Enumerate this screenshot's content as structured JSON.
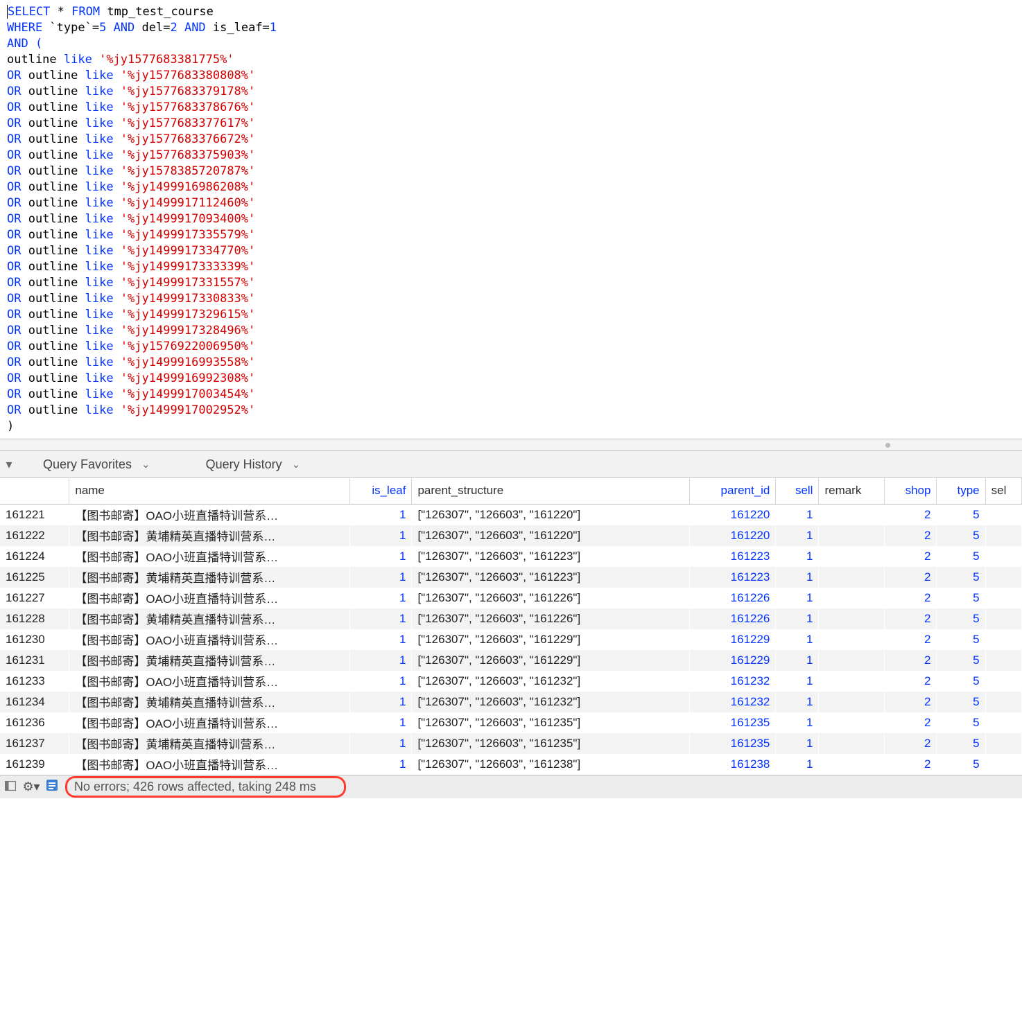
{
  "sql": {
    "l0_select": "SELECT",
    "l0_star": " * ",
    "l0_from": "FROM",
    "l0_tbl": " tmp_test_course",
    "l1_where": "WHERE",
    "l1_rest_a": " `type`=",
    "l1_5": "5",
    "l1_and1": " AND",
    "l1_del": " del=",
    "l1_2": "2",
    "l1_and2": " AND",
    "l1_isleaf": " is_leaf=",
    "l1_1": "1",
    "l2": "AND (",
    "l3_a": "outline ",
    "l3_like": "like",
    "l3_s": " '%jy1577683381775%'",
    "or": "OR",
    "outl": " outline ",
    "like": "like",
    "s4": " '%jy1577683380808%'",
    "s5": " '%jy1577683379178%'",
    "s6": " '%jy1577683378676%'",
    "s7": " '%jy1577683377617%'",
    "s8": " '%jy1577683376672%'",
    "s9": " '%jy1577683375903%'",
    "s10": " '%jy1578385720787%'",
    "s11": " '%jy1499916986208%'",
    "s12": " '%jy1499917112460%'",
    "s13": " '%jy1499917093400%'",
    "s14": " '%jy1499917335579%'",
    "s15": " '%jy1499917334770%'",
    "s16": " '%jy1499917333339%'",
    "s17": " '%jy1499917331557%'",
    "s18": " '%jy1499917330833%'",
    "s19": " '%jy1499917329615%'",
    "s20": " '%jy1499917328496%'",
    "s21": " '%jy1576922006950%'",
    "s22": " '%jy1499916993558%'",
    "s23": " '%jy1499916992308%'",
    "s24": " '%jy1499917003454%'",
    "s25": " '%jy1499917002952%'",
    "lz": ")"
  },
  "toolbar": {
    "favorites": "Query Favorites",
    "history": "Query History"
  },
  "headers": {
    "id": "",
    "name": "name",
    "is_leaf": "is_leaf",
    "parent_structure": "parent_structure",
    "parent_id": "parent_id",
    "sell": "sell",
    "remark": "remark",
    "shop": "shop",
    "type": "type",
    "sel": "sel"
  },
  "rows": [
    {
      "id": "161221",
      "name": "【图书邮寄】OAO小班直播特训营系…",
      "is_leaf": "1",
      "ps": "[\"126307\", \"126603\", \"161220\"]",
      "pid": "161220",
      "sell": "1",
      "remark": "",
      "shop": "2",
      "type": "5"
    },
    {
      "id": "161222",
      "name": "【图书邮寄】黄埔精英直播特训营系…",
      "is_leaf": "1",
      "ps": "[\"126307\", \"126603\", \"161220\"]",
      "pid": "161220",
      "sell": "1",
      "remark": "",
      "shop": "2",
      "type": "5"
    },
    {
      "id": "161224",
      "name": "【图书邮寄】OAO小班直播特训营系…",
      "is_leaf": "1",
      "ps": "[\"126307\", \"126603\", \"161223\"]",
      "pid": "161223",
      "sell": "1",
      "remark": "",
      "shop": "2",
      "type": "5"
    },
    {
      "id": "161225",
      "name": "【图书邮寄】黄埔精英直播特训营系…",
      "is_leaf": "1",
      "ps": "[\"126307\", \"126603\", \"161223\"]",
      "pid": "161223",
      "sell": "1",
      "remark": "",
      "shop": "2",
      "type": "5"
    },
    {
      "id": "161227",
      "name": "【图书邮寄】OAO小班直播特训营系…",
      "is_leaf": "1",
      "ps": "[\"126307\", \"126603\", \"161226\"]",
      "pid": "161226",
      "sell": "1",
      "remark": "",
      "shop": "2",
      "type": "5"
    },
    {
      "id": "161228",
      "name": "【图书邮寄】黄埔精英直播特训营系…",
      "is_leaf": "1",
      "ps": "[\"126307\", \"126603\", \"161226\"]",
      "pid": "161226",
      "sell": "1",
      "remark": "",
      "shop": "2",
      "type": "5"
    },
    {
      "id": "161230",
      "name": "【图书邮寄】OAO小班直播特训营系…",
      "is_leaf": "1",
      "ps": "[\"126307\", \"126603\", \"161229\"]",
      "pid": "161229",
      "sell": "1",
      "remark": "",
      "shop": "2",
      "type": "5"
    },
    {
      "id": "161231",
      "name": "【图书邮寄】黄埔精英直播特训营系…",
      "is_leaf": "1",
      "ps": "[\"126307\", \"126603\", \"161229\"]",
      "pid": "161229",
      "sell": "1",
      "remark": "",
      "shop": "2",
      "type": "5"
    },
    {
      "id": "161233",
      "name": "【图书邮寄】OAO小班直播特训营系…",
      "is_leaf": "1",
      "ps": "[\"126307\", \"126603\", \"161232\"]",
      "pid": "161232",
      "sell": "1",
      "remark": "",
      "shop": "2",
      "type": "5"
    },
    {
      "id": "161234",
      "name": "【图书邮寄】黄埔精英直播特训营系…",
      "is_leaf": "1",
      "ps": "[\"126307\", \"126603\", \"161232\"]",
      "pid": "161232",
      "sell": "1",
      "remark": "",
      "shop": "2",
      "type": "5"
    },
    {
      "id": "161236",
      "name": "【图书邮寄】OAO小班直播特训营系…",
      "is_leaf": "1",
      "ps": "[\"126307\", \"126603\", \"161235\"]",
      "pid": "161235",
      "sell": "1",
      "remark": "",
      "shop": "2",
      "type": "5"
    },
    {
      "id": "161237",
      "name": "【图书邮寄】黄埔精英直播特训营系…",
      "is_leaf": "1",
      "ps": "[\"126307\", \"126603\", \"161235\"]",
      "pid": "161235",
      "sell": "1",
      "remark": "",
      "shop": "2",
      "type": "5"
    },
    {
      "id": "161239",
      "name": "【图书邮寄】OAO小班直播特训营系…",
      "is_leaf": "1",
      "ps": "[\"126307\", \"126603\", \"161238\"]",
      "pid": "161238",
      "sell": "1",
      "remark": "",
      "shop": "2",
      "type": "5"
    }
  ],
  "status": {
    "message": "No errors; 426 rows affected, taking 248 ms"
  }
}
